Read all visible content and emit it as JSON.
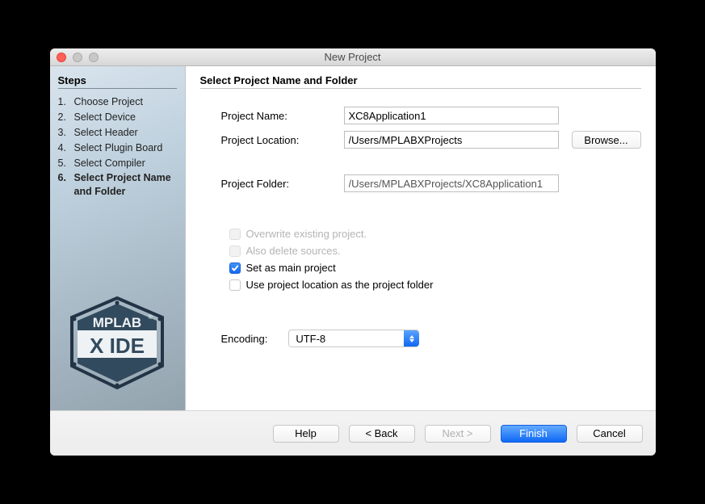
{
  "window": {
    "title": "New Project"
  },
  "sidebar": {
    "steps_heading": "Steps",
    "steps": [
      {
        "num": "1.",
        "label": "Choose Project"
      },
      {
        "num": "2.",
        "label": "Select Device"
      },
      {
        "num": "3.",
        "label": "Select Header"
      },
      {
        "num": "4.",
        "label": "Select Plugin Board"
      },
      {
        "num": "5.",
        "label": "Select Compiler"
      },
      {
        "num": "6.",
        "label": "Select Project Name and Folder"
      }
    ],
    "current_index": 5,
    "logo_line1": "MPLAB",
    "logo_line2": "X IDE"
  },
  "content": {
    "section_title": "Select Project Name and Folder",
    "fields": {
      "project_name": {
        "label": "Project Name:",
        "value": "XC8Application1"
      },
      "project_location": {
        "label": "Project Location:",
        "value": "/Users/MPLABXProjects",
        "browse_label": "Browse..."
      },
      "project_folder": {
        "label": "Project Folder:",
        "value": "/Users/MPLABXProjects/XC8Application1"
      }
    },
    "checkboxes": {
      "overwrite": {
        "label": "Overwrite existing project.",
        "checked": false,
        "disabled": true
      },
      "delete_sources": {
        "label": "Also delete sources.",
        "checked": false,
        "disabled": true
      },
      "set_main": {
        "label": "Set as main project",
        "checked": true,
        "disabled": false
      },
      "use_location": {
        "label": "Use project location as the project folder",
        "checked": false,
        "disabled": false
      }
    },
    "encoding": {
      "label": "Encoding:",
      "value": "UTF-8"
    }
  },
  "footer": {
    "help": "Help",
    "back": "< Back",
    "next": "Next >",
    "finish": "Finish",
    "cancel": "Cancel"
  }
}
